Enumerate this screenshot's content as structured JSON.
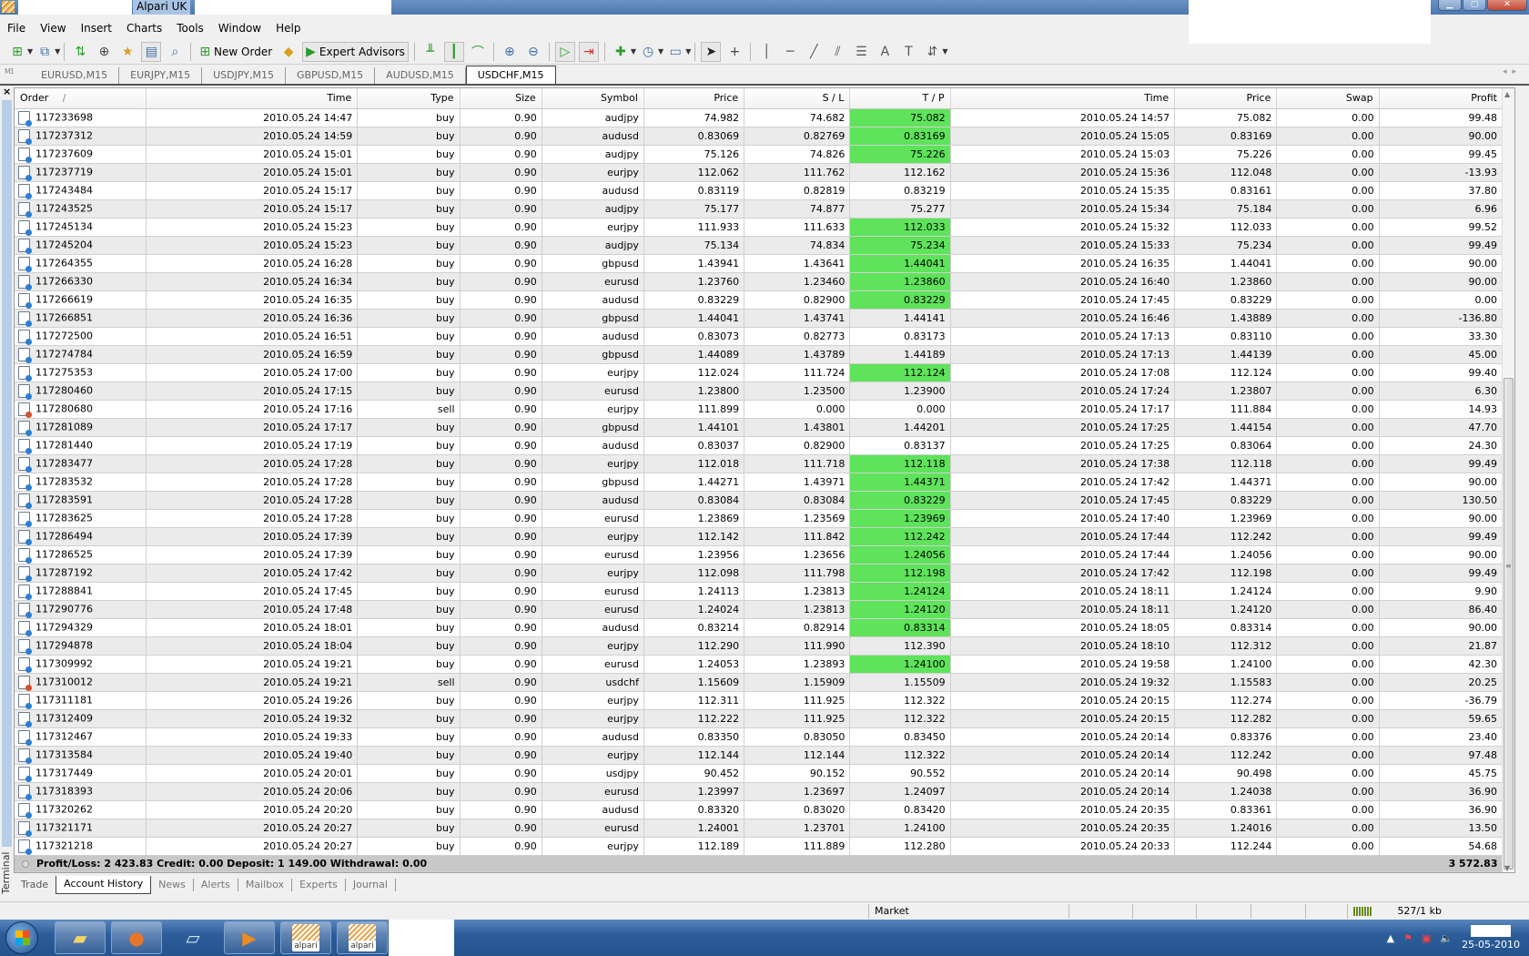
{
  "window": {
    "title": "Alpari UK",
    "controls": [
      "minimize",
      "maximize",
      "close"
    ]
  },
  "menu": [
    "File",
    "View",
    "Insert",
    "Charts",
    "Tools",
    "Window",
    "Help"
  ],
  "toolbar": {
    "new_order_label": "New Order",
    "expert_advisors_label": "Expert Advisors",
    "icons": [
      "new-chart-icon",
      "profiles-icon",
      "market-watch-icon",
      "navigator-icon",
      "data-window-icon",
      "terminal-icon",
      "strategy-tester-icon",
      "new-order-icon",
      "alert-icon",
      "expert-advisors-icon",
      "bar-chart-icon",
      "candlestick-icon",
      "line-chart-icon",
      "zoom-in-icon",
      "zoom-out-icon",
      "auto-scroll-icon",
      "chart-shift-icon",
      "indicators-icon",
      "periods-icon",
      "templates-icon",
      "cursor-icon",
      "crosshair-icon",
      "vertical-line-icon",
      "horizontal-line-icon",
      "trendline-icon",
      "equidistant-channel-icon",
      "fibonacci-icon",
      "text-icon",
      "text-label-icon",
      "arrows-icon"
    ]
  },
  "chart_tabs": {
    "left_label": "M1",
    "tabs": [
      "EURUSD,M15",
      "EURJPY,M15",
      "USDJPY,M15",
      "GBPUSD,M15",
      "AUDUSD,M15",
      "USDCHF,M15"
    ],
    "active": "USDCHF,M15"
  },
  "terminal": {
    "side_label": "Terminal",
    "columns": [
      "Order",
      "Time",
      "Type",
      "Size",
      "Symbol",
      "Price",
      "S / L",
      "T / P",
      "Time",
      "Price",
      "Swap",
      "Profit"
    ],
    "sort_indicator": "/",
    "tp_hit_color": "#5ee35a",
    "rows": [
      {
        "order": "117233698",
        "open_time": "2010.05.24 14:47",
        "type": "buy",
        "size": "0.90",
        "symbol": "audjpy",
        "open_price": "74.982",
        "sl": "74.682",
        "tp": "75.082",
        "tp_hit": true,
        "close_time": "2010.05.24 14:57",
        "close_price": "75.082",
        "swap": "0.00",
        "profit": "99.48"
      },
      {
        "order": "117237312",
        "open_time": "2010.05.24 14:59",
        "type": "buy",
        "size": "0.90",
        "symbol": "audusd",
        "open_price": "0.83069",
        "sl": "0.82769",
        "tp": "0.83169",
        "tp_hit": true,
        "close_time": "2010.05.24 15:05",
        "close_price": "0.83169",
        "swap": "0.00",
        "profit": "90.00"
      },
      {
        "order": "117237609",
        "open_time": "2010.05.24 15:01",
        "type": "buy",
        "size": "0.90",
        "symbol": "audjpy",
        "open_price": "75.126",
        "sl": "74.826",
        "tp": "75.226",
        "tp_hit": true,
        "close_time": "2010.05.24 15:03",
        "close_price": "75.226",
        "swap": "0.00",
        "profit": "99.45"
      },
      {
        "order": "117237719",
        "open_time": "2010.05.24 15:01",
        "type": "buy",
        "size": "0.90",
        "symbol": "eurjpy",
        "open_price": "112.062",
        "sl": "111.762",
        "tp": "112.162",
        "tp_hit": false,
        "close_time": "2010.05.24 15:36",
        "close_price": "112.048",
        "swap": "0.00",
        "profit": "-13.93"
      },
      {
        "order": "117243484",
        "open_time": "2010.05.24 15:17",
        "type": "buy",
        "size": "0.90",
        "symbol": "audusd",
        "open_price": "0.83119",
        "sl": "0.82819",
        "tp": "0.83219",
        "tp_hit": false,
        "close_time": "2010.05.24 15:35",
        "close_price": "0.83161",
        "swap": "0.00",
        "profit": "37.80"
      },
      {
        "order": "117243525",
        "open_time": "2010.05.24 15:17",
        "type": "buy",
        "size": "0.90",
        "symbol": "audjpy",
        "open_price": "75.177",
        "sl": "74.877",
        "tp": "75.277",
        "tp_hit": false,
        "close_time": "2010.05.24 15:34",
        "close_price": "75.184",
        "swap": "0.00",
        "profit": "6.96"
      },
      {
        "order": "117245134",
        "open_time": "2010.05.24 15:23",
        "type": "buy",
        "size": "0.90",
        "symbol": "eurjpy",
        "open_price": "111.933",
        "sl": "111.633",
        "tp": "112.033",
        "tp_hit": true,
        "close_time": "2010.05.24 15:32",
        "close_price": "112.033",
        "swap": "0.00",
        "profit": "99.52"
      },
      {
        "order": "117245204",
        "open_time": "2010.05.24 15:23",
        "type": "buy",
        "size": "0.90",
        "symbol": "audjpy",
        "open_price": "75.134",
        "sl": "74.834",
        "tp": "75.234",
        "tp_hit": true,
        "close_time": "2010.05.24 15:33",
        "close_price": "75.234",
        "swap": "0.00",
        "profit": "99.49"
      },
      {
        "order": "117264355",
        "open_time": "2010.05.24 16:28",
        "type": "buy",
        "size": "0.90",
        "symbol": "gbpusd",
        "open_price": "1.43941",
        "sl": "1.43641",
        "tp": "1.44041",
        "tp_hit": true,
        "close_time": "2010.05.24 16:35",
        "close_price": "1.44041",
        "swap": "0.00",
        "profit": "90.00"
      },
      {
        "order": "117266330",
        "open_time": "2010.05.24 16:34",
        "type": "buy",
        "size": "0.90",
        "symbol": "eurusd",
        "open_price": "1.23760",
        "sl": "1.23460",
        "tp": "1.23860",
        "tp_hit": true,
        "close_time": "2010.05.24 16:40",
        "close_price": "1.23860",
        "swap": "0.00",
        "profit": "90.00"
      },
      {
        "order": "117266619",
        "open_time": "2010.05.24 16:35",
        "type": "buy",
        "size": "0.90",
        "symbol": "audusd",
        "open_price": "0.83229",
        "sl": "0.82900",
        "tp": "0.83229",
        "tp_hit": true,
        "close_time": "2010.05.24 17:45",
        "close_price": "0.83229",
        "swap": "0.00",
        "profit": "0.00"
      },
      {
        "order": "117266851",
        "open_time": "2010.05.24 16:36",
        "type": "buy",
        "size": "0.90",
        "symbol": "gbpusd",
        "open_price": "1.44041",
        "sl": "1.43741",
        "tp": "1.44141",
        "tp_hit": false,
        "close_time": "2010.05.24 16:46",
        "close_price": "1.43889",
        "swap": "0.00",
        "profit": "-136.80"
      },
      {
        "order": "117272500",
        "open_time": "2010.05.24 16:51",
        "type": "buy",
        "size": "0.90",
        "symbol": "audusd",
        "open_price": "0.83073",
        "sl": "0.82773",
        "tp": "0.83173",
        "tp_hit": false,
        "close_time": "2010.05.24 17:13",
        "close_price": "0.83110",
        "swap": "0.00",
        "profit": "33.30"
      },
      {
        "order": "117274784",
        "open_time": "2010.05.24 16:59",
        "type": "buy",
        "size": "0.90",
        "symbol": "gbpusd",
        "open_price": "1.44089",
        "sl": "1.43789",
        "tp": "1.44189",
        "tp_hit": false,
        "close_time": "2010.05.24 17:13",
        "close_price": "1.44139",
        "swap": "0.00",
        "profit": "45.00"
      },
      {
        "order": "117275353",
        "open_time": "2010.05.24 17:00",
        "type": "buy",
        "size": "0.90",
        "symbol": "eurjpy",
        "open_price": "112.024",
        "sl": "111.724",
        "tp": "112.124",
        "tp_hit": true,
        "close_time": "2010.05.24 17:08",
        "close_price": "112.124",
        "swap": "0.00",
        "profit": "99.40"
      },
      {
        "order": "117280460",
        "open_time": "2010.05.24 17:15",
        "type": "buy",
        "size": "0.90",
        "symbol": "eurusd",
        "open_price": "1.23800",
        "sl": "1.23500",
        "tp": "1.23900",
        "tp_hit": false,
        "close_time": "2010.05.24 17:24",
        "close_price": "1.23807",
        "swap": "0.00",
        "profit": "6.30"
      },
      {
        "order": "117280680",
        "open_time": "2010.05.24 17:16",
        "type": "sell",
        "size": "0.90",
        "symbol": "eurjpy",
        "open_price": "111.899",
        "sl": "0.000",
        "tp": "0.000",
        "tp_hit": false,
        "close_time": "2010.05.24 17:17",
        "close_price": "111.884",
        "swap": "0.00",
        "profit": "14.93"
      },
      {
        "order": "117281089",
        "open_time": "2010.05.24 17:17",
        "type": "buy",
        "size": "0.90",
        "symbol": "gbpusd",
        "open_price": "1.44101",
        "sl": "1.43801",
        "tp": "1.44201",
        "tp_hit": false,
        "close_time": "2010.05.24 17:25",
        "close_price": "1.44154",
        "swap": "0.00",
        "profit": "47.70"
      },
      {
        "order": "117281440",
        "open_time": "2010.05.24 17:19",
        "type": "buy",
        "size": "0.90",
        "symbol": "audusd",
        "open_price": "0.83037",
        "sl": "0.82900",
        "tp": "0.83137",
        "tp_hit": false,
        "close_time": "2010.05.24 17:25",
        "close_price": "0.83064",
        "swap": "0.00",
        "profit": "24.30"
      },
      {
        "order": "117283477",
        "open_time": "2010.05.24 17:28",
        "type": "buy",
        "size": "0.90",
        "symbol": "eurjpy",
        "open_price": "112.018",
        "sl": "111.718",
        "tp": "112.118",
        "tp_hit": true,
        "close_time": "2010.05.24 17:38",
        "close_price": "112.118",
        "swap": "0.00",
        "profit": "99.49"
      },
      {
        "order": "117283532",
        "open_time": "2010.05.24 17:28",
        "type": "buy",
        "size": "0.90",
        "symbol": "gbpusd",
        "open_price": "1.44271",
        "sl": "1.43971",
        "tp": "1.44371",
        "tp_hit": true,
        "close_time": "2010.05.24 17:42",
        "close_price": "1.44371",
        "swap": "0.00",
        "profit": "90.00"
      },
      {
        "order": "117283591",
        "open_time": "2010.05.24 17:28",
        "type": "buy",
        "size": "0.90",
        "symbol": "audusd",
        "open_price": "0.83084",
        "sl": "0.83084",
        "tp": "0.83229",
        "tp_hit": true,
        "close_time": "2010.05.24 17:45",
        "close_price": "0.83229",
        "swap": "0.00",
        "profit": "130.50"
      },
      {
        "order": "117283625",
        "open_time": "2010.05.24 17:28",
        "type": "buy",
        "size": "0.90",
        "symbol": "eurusd",
        "open_price": "1.23869",
        "sl": "1.23569",
        "tp": "1.23969",
        "tp_hit": true,
        "close_time": "2010.05.24 17:40",
        "close_price": "1.23969",
        "swap": "0.00",
        "profit": "90.00"
      },
      {
        "order": "117286494",
        "open_time": "2010.05.24 17:39",
        "type": "buy",
        "size": "0.90",
        "symbol": "eurjpy",
        "open_price": "112.142",
        "sl": "111.842",
        "tp": "112.242",
        "tp_hit": true,
        "close_time": "2010.05.24 17:44",
        "close_price": "112.242",
        "swap": "0.00",
        "profit": "99.49"
      },
      {
        "order": "117286525",
        "open_time": "2010.05.24 17:39",
        "type": "buy",
        "size": "0.90",
        "symbol": "eurusd",
        "open_price": "1.23956",
        "sl": "1.23656",
        "tp": "1.24056",
        "tp_hit": true,
        "close_time": "2010.05.24 17:44",
        "close_price": "1.24056",
        "swap": "0.00",
        "profit": "90.00"
      },
      {
        "order": "117287192",
        "open_time": "2010.05.24 17:42",
        "type": "buy",
        "size": "0.90",
        "symbol": "eurjpy",
        "open_price": "112.098",
        "sl": "111.798",
        "tp": "112.198",
        "tp_hit": true,
        "close_time": "2010.05.24 17:42",
        "close_price": "112.198",
        "swap": "0.00",
        "profit": "99.49"
      },
      {
        "order": "117288841",
        "open_time": "2010.05.24 17:45",
        "type": "buy",
        "size": "0.90",
        "symbol": "eurusd",
        "open_price": "1.24113",
        "sl": "1.23813",
        "tp": "1.24124",
        "tp_hit": true,
        "close_time": "2010.05.24 18:11",
        "close_price": "1.24124",
        "swap": "0.00",
        "profit": "9.90"
      },
      {
        "order": "117290776",
        "open_time": "2010.05.24 17:48",
        "type": "buy",
        "size": "0.90",
        "symbol": "eurusd",
        "open_price": "1.24024",
        "sl": "1.23813",
        "tp": "1.24120",
        "tp_hit": true,
        "close_time": "2010.05.24 18:11",
        "close_price": "1.24120",
        "swap": "0.00",
        "profit": "86.40"
      },
      {
        "order": "117294329",
        "open_time": "2010.05.24 18:01",
        "type": "buy",
        "size": "0.90",
        "symbol": "audusd",
        "open_price": "0.83214",
        "sl": "0.82914",
        "tp": "0.83314",
        "tp_hit": true,
        "close_time": "2010.05.24 18:05",
        "close_price": "0.83314",
        "swap": "0.00",
        "profit": "90.00"
      },
      {
        "order": "117294878",
        "open_time": "2010.05.24 18:04",
        "type": "buy",
        "size": "0.90",
        "symbol": "eurjpy",
        "open_price": "112.290",
        "sl": "111.990",
        "tp": "112.390",
        "tp_hit": false,
        "close_time": "2010.05.24 18:10",
        "close_price": "112.312",
        "swap": "0.00",
        "profit": "21.87"
      },
      {
        "order": "117309992",
        "open_time": "2010.05.24 19:21",
        "type": "buy",
        "size": "0.90",
        "symbol": "eurusd",
        "open_price": "1.24053",
        "sl": "1.23893",
        "tp": "1.24100",
        "tp_hit": true,
        "close_time": "2010.05.24 19:58",
        "close_price": "1.24100",
        "swap": "0.00",
        "profit": "42.30"
      },
      {
        "order": "117310012",
        "open_time": "2010.05.24 19:21",
        "type": "sell",
        "size": "0.90",
        "symbol": "usdchf",
        "open_price": "1.15609",
        "sl": "1.15909",
        "tp": "1.15509",
        "tp_hit": false,
        "close_time": "2010.05.24 19:32",
        "close_price": "1.15583",
        "swap": "0.00",
        "profit": "20.25"
      },
      {
        "order": "117311181",
        "open_time": "2010.05.24 19:26",
        "type": "buy",
        "size": "0.90",
        "symbol": "eurjpy",
        "open_price": "112.311",
        "sl": "111.925",
        "tp": "112.322",
        "tp_hit": false,
        "close_time": "2010.05.24 20:15",
        "close_price": "112.274",
        "swap": "0.00",
        "profit": "-36.79"
      },
      {
        "order": "117312409",
        "open_time": "2010.05.24 19:32",
        "type": "buy",
        "size": "0.90",
        "symbol": "eurjpy",
        "open_price": "112.222",
        "sl": "111.925",
        "tp": "112.322",
        "tp_hit": false,
        "close_time": "2010.05.24 20:15",
        "close_price": "112.282",
        "swap": "0.00",
        "profit": "59.65"
      },
      {
        "order": "117312467",
        "open_time": "2010.05.24 19:33",
        "type": "buy",
        "size": "0.90",
        "symbol": "audusd",
        "open_price": "0.83350",
        "sl": "0.83050",
        "tp": "0.83450",
        "tp_hit": false,
        "close_time": "2010.05.24 20:14",
        "close_price": "0.83376",
        "swap": "0.00",
        "profit": "23.40"
      },
      {
        "order": "117313584",
        "open_time": "2010.05.24 19:40",
        "type": "buy",
        "size": "0.90",
        "symbol": "eurjpy",
        "open_price": "112.144",
        "sl": "112.144",
        "tp": "112.322",
        "tp_hit": false,
        "close_time": "2010.05.24 20:14",
        "close_price": "112.242",
        "swap": "0.00",
        "profit": "97.48"
      },
      {
        "order": "117317449",
        "open_time": "2010.05.24 20:01",
        "type": "buy",
        "size": "0.90",
        "symbol": "usdjpy",
        "open_price": "90.452",
        "sl": "90.152",
        "tp": "90.552",
        "tp_hit": false,
        "close_time": "2010.05.24 20:14",
        "close_price": "90.498",
        "swap": "0.00",
        "profit": "45.75"
      },
      {
        "order": "117318393",
        "open_time": "2010.05.24 20:06",
        "type": "buy",
        "size": "0.90",
        "symbol": "eurusd",
        "open_price": "1.23997",
        "sl": "1.23697",
        "tp": "1.24097",
        "tp_hit": false,
        "close_time": "2010.05.24 20:14",
        "close_price": "1.24038",
        "swap": "0.00",
        "profit": "36.90"
      },
      {
        "order": "117320262",
        "open_time": "2010.05.24 20:20",
        "type": "buy",
        "size": "0.90",
        "symbol": "audusd",
        "open_price": "0.83320",
        "sl": "0.83020",
        "tp": "0.83420",
        "tp_hit": false,
        "close_time": "2010.05.24 20:35",
        "close_price": "0.83361",
        "swap": "0.00",
        "profit": "36.90"
      },
      {
        "order": "117321171",
        "open_time": "2010.05.24 20:27",
        "type": "buy",
        "size": "0.90",
        "symbol": "eurusd",
        "open_price": "1.24001",
        "sl": "1.23701",
        "tp": "1.24100",
        "tp_hit": false,
        "close_time": "2010.05.24 20:35",
        "close_price": "1.24016",
        "swap": "0.00",
        "profit": "13.50"
      },
      {
        "order": "117321218",
        "open_time": "2010.05.24 20:27",
        "type": "buy",
        "size": "0.90",
        "symbol": "eurjpy",
        "open_price": "112.189",
        "sl": "111.889",
        "tp": "112.280",
        "tp_hit": false,
        "close_time": "2010.05.24 20:33",
        "close_price": "112.244",
        "swap": "0.00",
        "profit": "54.68"
      }
    ],
    "summary": {
      "text": "Profit/Loss: 2 423.83  Credit: 0.00  Deposit: 1 149.00  Withdrawal: 0.00",
      "total": "3 572.83"
    },
    "tabs": [
      "Trade",
      "Account History",
      "News",
      "Alerts",
      "Mailbox",
      "Experts",
      "Journal"
    ],
    "active_tab": "Account History"
  },
  "statusbar": {
    "connection_status": "Market",
    "traffic": "527/1 kb"
  },
  "taskbar": {
    "apps": [
      "windows-explorer",
      "firefox",
      "notepad",
      "media-player",
      "alpari",
      "alpari"
    ],
    "alpari_label": "alpari",
    "date": "25-05-2010"
  }
}
